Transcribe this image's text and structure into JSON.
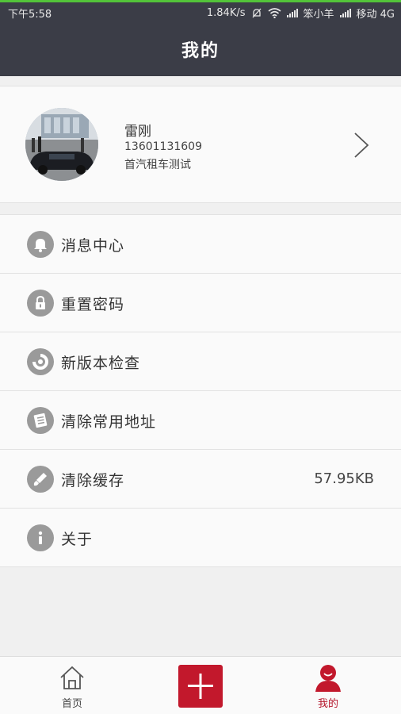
{
  "status_bar": {
    "time": "下午5:58",
    "net_speed": "1.84K/s",
    "carrier1": "笨小羊",
    "carrier2": "移动 4G"
  },
  "header": {
    "title": "我的"
  },
  "profile": {
    "name": "雷刚",
    "phone": "13601131609",
    "company": "首汽租车测试"
  },
  "menu": [
    {
      "label": "消息中心",
      "icon": "bell-icon"
    },
    {
      "label": "重置密码",
      "icon": "lock-icon"
    },
    {
      "label": "新版本检查",
      "icon": "refresh-icon"
    },
    {
      "label": "清除常用地址",
      "icon": "list-icon"
    },
    {
      "label": "清除缓存",
      "icon": "brush-icon",
      "value": "57.95KB"
    },
    {
      "label": "关于",
      "icon": "info-icon"
    }
  ],
  "bottom_nav": {
    "home_label": "首页",
    "mine_label": "我的",
    "active": "mine",
    "accent_color": "#c2182c"
  },
  "colors": {
    "header_bg": "#3b3d47",
    "accent": "#c2182c",
    "icon_gray": "#9a9a9a"
  }
}
